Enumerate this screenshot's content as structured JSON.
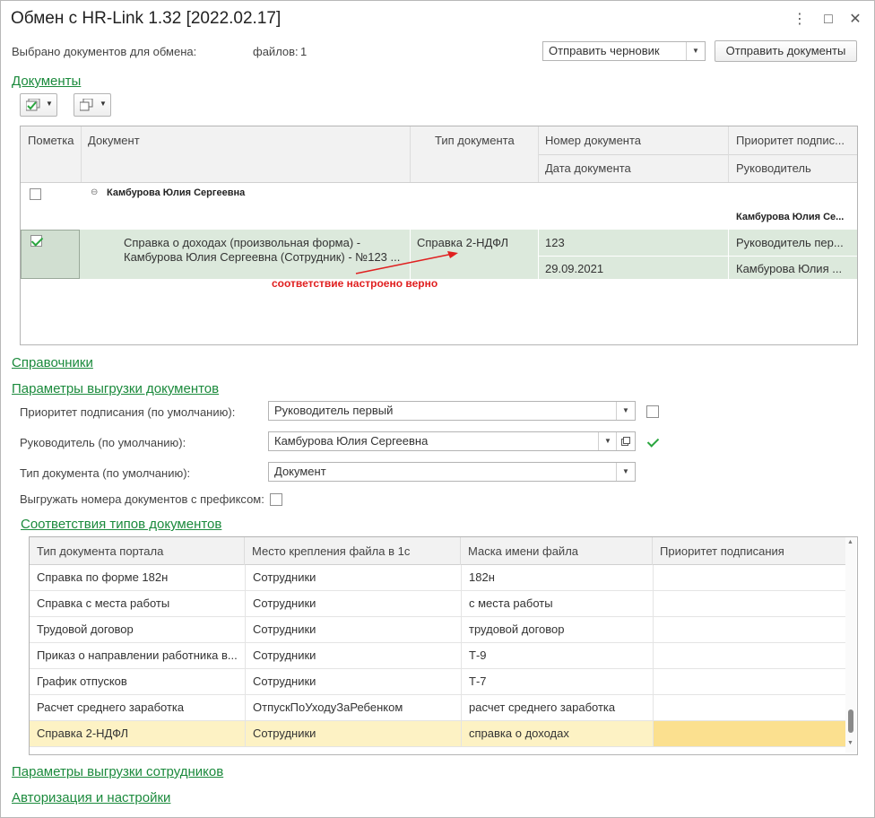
{
  "window": {
    "title": "Обмен с HR-Link 1.32 [2022.02.17]",
    "menu_glyph": "⋮",
    "maximize_glyph": "□",
    "close_glyph": "✕"
  },
  "top_bar": {
    "selected_label": "Выбрано документов для обмена:",
    "files_label": "файлов:",
    "files_count": "1",
    "send_mode_value": "Отправить черновик",
    "send_button": "Отправить документы"
  },
  "sections": {
    "documents": "Документы",
    "references": "Справочники",
    "export_params": "Параметры выгрузки документов",
    "type_mapping": "Соответствия типов документов",
    "employee_params": "Параметры выгрузки сотрудников",
    "auth": "Авторизация и настройки"
  },
  "documents_table": {
    "headers": {
      "mark": "Пометка",
      "document": "Документ",
      "doc_type": "Тип документа",
      "doc_number": "Номер документа",
      "doc_date": "Дата документа",
      "priority": "Приоритет подпис...",
      "manager": "Руководитель"
    },
    "group": {
      "name": "Камбурова Юлия Сергеевна",
      "right_name": "Камбурова Юлия Се..."
    },
    "row": {
      "document_line1": "Справка о доходах (произвольная форма) -",
      "document_line2": "Камбурова Юлия Сергеевна (Сотрудник) - №123 ...",
      "doc_type": "Справка 2-НДФЛ",
      "number": "123",
      "date": "29.09.2021",
      "priority": "Руководитель пер...",
      "manager": "Камбурова Юлия ..."
    },
    "annotation": "соответствие настроено верно",
    "annotation_color": "#e02020"
  },
  "export_params": {
    "priority_label": "Приоритет подписания (по умолчанию):",
    "priority_value": "Руководитель первый",
    "manager_label": "Руководитель (по умолчанию):",
    "manager_value": "Камбурова Юлия Сергеевна",
    "doctype_label": "Тип документа (по умолчанию):",
    "doctype_value": "Документ",
    "prefix_label": "Выгружать номера документов с префиксом:"
  },
  "mapping_table": {
    "headers": [
      "Тип документа портала",
      "Место крепления файла в 1с",
      "Маска имени файла",
      "Приоритет подписания"
    ],
    "rows": [
      [
        "Справка по форме 182н",
        "Сотрудники",
        "182н",
        ""
      ],
      [
        "Справка с места работы",
        "Сотрудники",
        "с места работы",
        ""
      ],
      [
        "Трудовой договор",
        "Сотрудники",
        "трудовой договор",
        ""
      ],
      [
        "Приказ о направлении работника в...",
        "Сотрудники",
        "Т-9",
        ""
      ],
      [
        "График отпусков",
        "Сотрудники",
        "Т-7",
        ""
      ],
      [
        "Расчет среднего заработка",
        "ОтпускПоУходуЗаРебенком",
        "расчет среднего заработка",
        ""
      ],
      [
        "Справка 2-НДФЛ",
        "Сотрудники",
        "справка о доходах",
        ""
      ]
    ],
    "selected_row": 6
  },
  "colors": {
    "accent_green": "#1b8a3c",
    "selected_row_green": "#dce9dc",
    "selected_row_yellow": "#fdf2c4",
    "selected_cell_yellow": "#fbe08f"
  }
}
